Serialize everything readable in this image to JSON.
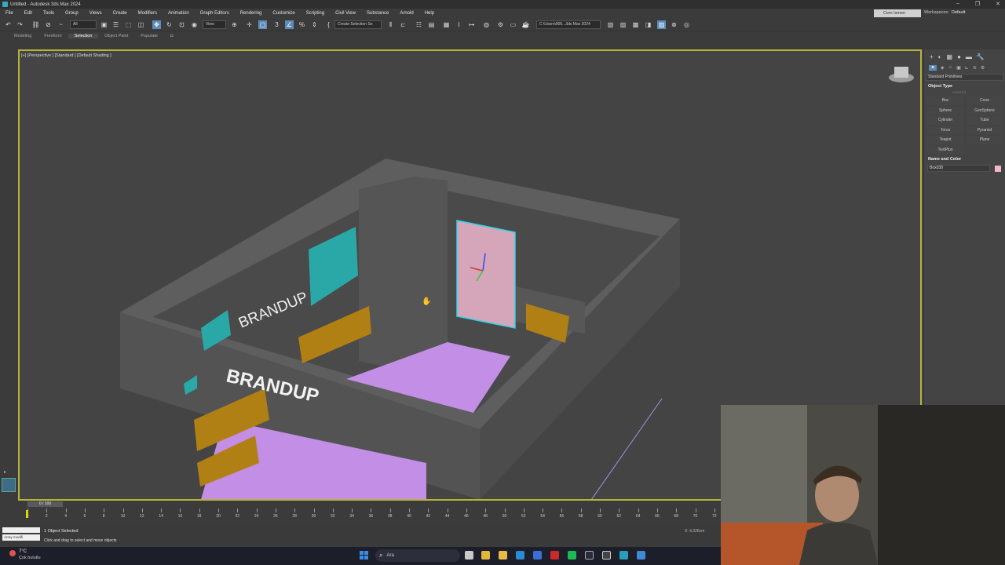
{
  "window": {
    "title": "Untitled - Autodesk 3ds Max 2024",
    "controls": [
      "–",
      "❐",
      "✕"
    ]
  },
  "menu": {
    "items": [
      "File",
      "Edit",
      "Tools",
      "Group",
      "Views",
      "Create",
      "Modifiers",
      "Animation",
      "Graph Editors",
      "Rendering",
      "Customize",
      "Scripting",
      "Civil View",
      "Substance",
      "Arnold",
      "Help"
    ],
    "user": "Cem Ismen",
    "workspaces_label": "Workspaces:",
    "workspaces_value": "Default"
  },
  "toolbar": {
    "filter_value": "All",
    "ref_coord": "View",
    "selection_set_placeholder": "Create Selection Se",
    "project_path": "C:\\Users\\905...3ds Max 2024"
  },
  "ribbon": {
    "tabs": [
      "Modeling",
      "Freeform",
      "Selection",
      "Object Paint",
      "Populate"
    ],
    "active": "Selection"
  },
  "viewport": {
    "label": "[+] [Perspective ] [Standard ] [Default Shading ]",
    "signs": [
      "BRANDUP",
      "BRANDUP"
    ],
    "colors": {
      "wall": "#595959",
      "floor": "#c38ee6",
      "panel": "#2aa8a8",
      "selected_panel": "#d5a6b9",
      "selection_outline": "#2fd5e6",
      "wood": "#b08015",
      "border": "#b8b33c"
    }
  },
  "command_panel": {
    "tab_icons": [
      "plus-icon",
      "modify-icon",
      "hierarchy-icon",
      "motion-icon",
      "display-icon",
      "utilities-icon"
    ],
    "category": "Standard Primitives",
    "object_type_header": "Object Type",
    "autogrid": "AutoGrid",
    "object_buttons": [
      "Box",
      "Cone",
      "Sphere",
      "GeoSphere",
      "Cylinder",
      "Tube",
      "Torus",
      "Pyramid",
      "Teapot",
      "Plane",
      "TextPlus"
    ],
    "name_color_header": "Name and Color",
    "object_name": "Box038",
    "object_color": "#f0b7c8"
  },
  "timeline": {
    "frame_display": "0 / 100",
    "ticks": [
      "0",
      "2",
      "4",
      "6",
      "8",
      "10",
      "12",
      "14",
      "16",
      "18",
      "20",
      "22",
      "24",
      "26",
      "28",
      "30",
      "32",
      "34",
      "36",
      "38",
      "40",
      "42",
      "44",
      "46",
      "48",
      "50",
      "52",
      "54",
      "56",
      "58",
      "60",
      "62",
      "64",
      "66",
      "68",
      "70",
      "72"
    ]
  },
  "status": {
    "script_line": "Array modifi",
    "selection": "1 Object Selected",
    "prompt": "Click and drag to select and move objects",
    "coord": "X: 9,326cm"
  },
  "taskbar": {
    "temperature": "7°C",
    "weather": "Çok bulutlu",
    "search_placeholder": "Ara"
  }
}
